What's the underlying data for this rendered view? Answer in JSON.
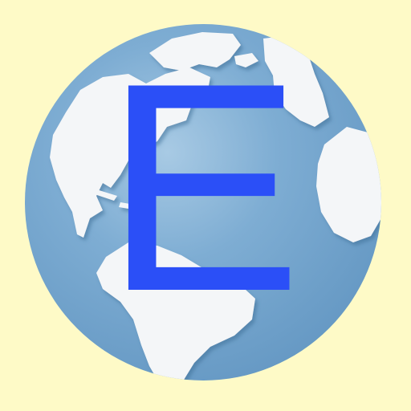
{
  "icon": {
    "letter": "E",
    "letter_color": "#2b4ff7",
    "background_color": "#fefac7",
    "globe_ocean_color": "#6fa2cb",
    "globe_highlight_color": "#a8cae4",
    "land_color": "#f4f6f8",
    "land_shadow_color": "#5a88b0",
    "globe_icon": "globe-icon"
  }
}
